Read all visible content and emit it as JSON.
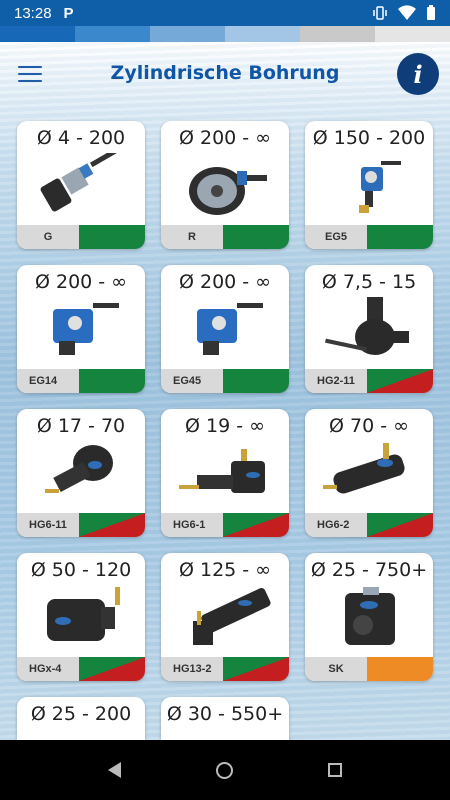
{
  "status": {
    "time": "13:28",
    "notification_icon": "P"
  },
  "header": {
    "title": "Zylindrische Bohrung",
    "info_label": "i"
  },
  "colors": {
    "brand": "#0f57a6",
    "green": "#14843f",
    "red": "#c41e20",
    "orange": "#ef8b25"
  },
  "cards": [
    {
      "range": "Ø 4 - 200",
      "code": "G",
      "status": "green"
    },
    {
      "range": "Ø 200 - ∞",
      "code": "R",
      "status": "green"
    },
    {
      "range": "Ø 150 - 200",
      "code": "EG5",
      "status": "green"
    },
    {
      "range": "Ø 200 - ∞",
      "code": "EG14",
      "status": "green"
    },
    {
      "range": "Ø 200 - ∞",
      "code": "EG45",
      "status": "green"
    },
    {
      "range": "Ø 7,5 - 15",
      "code": "HG2-11",
      "status": "green-red"
    },
    {
      "range": "Ø 17 - 70",
      "code": "HG6-11",
      "status": "green-red"
    },
    {
      "range": "Ø 19 - ∞",
      "code": "HG6-1",
      "status": "green-red"
    },
    {
      "range": "Ø 70 - ∞",
      "code": "HG6-2",
      "status": "green-red"
    },
    {
      "range": "Ø 50 - 120",
      "code": "HGx-4",
      "status": "green-red"
    },
    {
      "range": "Ø 125 - ∞",
      "code": "HG13-2",
      "status": "green-red"
    },
    {
      "range": "Ø 25 - 750+",
      "code": "SK",
      "status": "orange"
    },
    {
      "range": "Ø 25 - 200",
      "code": "",
      "status": ""
    },
    {
      "range": "Ø 30 - 550+",
      "code": "",
      "status": ""
    }
  ],
  "pager": {
    "pages": 2,
    "current": 1
  }
}
